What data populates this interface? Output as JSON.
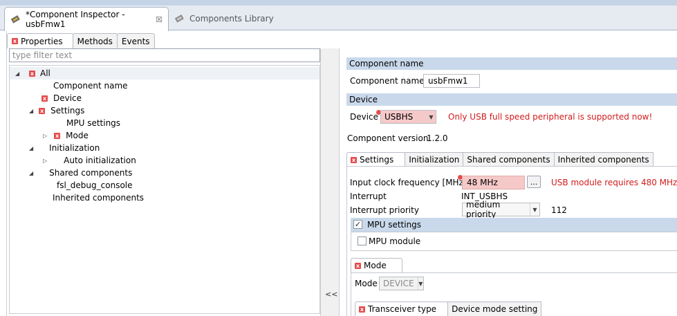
{
  "editor_tabs": [
    {
      "label": "*Component Inspector - usbFmw1",
      "close": "☒"
    },
    {
      "label": "Components Library"
    }
  ],
  "left": {
    "tabs": [
      "Properties",
      "Methods",
      "Events"
    ],
    "filter_placeholder": "type filter text",
    "tree": [
      {
        "label": "All"
      },
      {
        "label": "Component name"
      },
      {
        "label": "Device"
      },
      {
        "label": "Settings"
      },
      {
        "label": "MPU settings"
      },
      {
        "label": "Mode"
      },
      {
        "label": "Initialization"
      },
      {
        "label": "Auto initialization"
      },
      {
        "label": "Shared components"
      },
      {
        "label": "fsl_debug_console"
      },
      {
        "label": "Inherited components"
      }
    ]
  },
  "splitter": {
    "collapse_label": "<<"
  },
  "right": {
    "component_name_header": "Component name",
    "component_name_label": "Component name",
    "component_name_value": "usbFmw1",
    "device_header": "Device",
    "device_label": "Device",
    "device_value": "USBHS",
    "device_error": "Only USB full speed peripheral is supported now!",
    "component_version_label": "Component version",
    "component_version_value": "1.2.0",
    "tabs": [
      "Settings",
      "Initialization",
      "Shared components",
      "Inherited components"
    ],
    "settings": {
      "input_clock_label": "Input clock frequency [MHz]",
      "input_clock_value": "48 MHz",
      "browse_label": "...",
      "input_clock_error": "USB module requires 480 MHz",
      "interrupt_label": "Interrupt",
      "interrupt_value": "INT_USBHS",
      "interrupt_priority_label": "Interrupt priority",
      "interrupt_priority_value": "medium priority",
      "interrupt_priority_number": "112",
      "mpu_settings_label": "MPU settings",
      "mpu_settings_checked": true,
      "mpu_module_label": "MPU module",
      "mpu_module_checked": false
    },
    "mode": {
      "header": "Mode",
      "label": "Mode",
      "value": "DEVICE",
      "subtabs": [
        "Transceiver type",
        "Device mode setting"
      ]
    }
  },
  "colors": {
    "section_header": "#c9d9eb",
    "error_text": "#d01c1c",
    "error_field": "#f6c9c9"
  }
}
